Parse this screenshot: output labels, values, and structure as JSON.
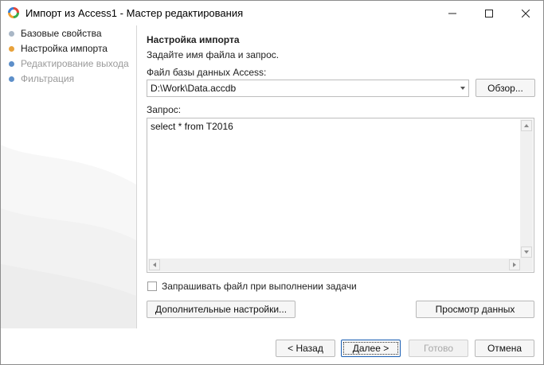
{
  "window": {
    "title": "Импорт из Access1 - Мастер редактирования"
  },
  "steps": [
    {
      "label": "Базовые свойства",
      "state": "done",
      "color": "#a9b7c6"
    },
    {
      "label": "Настройка импорта",
      "state": "active",
      "color": "#e8a23b"
    },
    {
      "label": "Редактирование выхода",
      "state": "future",
      "color": "#5d8fc9"
    },
    {
      "label": "Фильтрация",
      "state": "future",
      "color": "#5d8fc9"
    }
  ],
  "main": {
    "heading": "Настройка импорта",
    "subheading": "Задайте имя файла и запрос.",
    "file_label": "Файл базы данных Access:",
    "file_value": "D:\\Work\\Data.accdb",
    "browse_label": "Обзор...",
    "query_label": "Запрос:",
    "query_text": "select * from T2016",
    "ask_file_label": "Запрашивать файл при выполнении задачи",
    "ask_file_checked": false,
    "advanced_label": "Дополнительные настройки...",
    "preview_label": "Просмотр данных"
  },
  "footer": {
    "back_label": "< Назад",
    "next_label": "Далее >",
    "finish_label": "Готово",
    "cancel_label": "Отмена"
  },
  "colors": {
    "accent": "#1a5fb4",
    "icon_red": "#e0483a",
    "icon_green": "#3bab4a",
    "icon_orange": "#f0a030",
    "icon_blue": "#3a7fd5"
  },
  "icons": [
    "app-logo-icon",
    "minimize-icon",
    "maximize-icon",
    "close-icon",
    "dropdown-arrow-icon"
  ]
}
